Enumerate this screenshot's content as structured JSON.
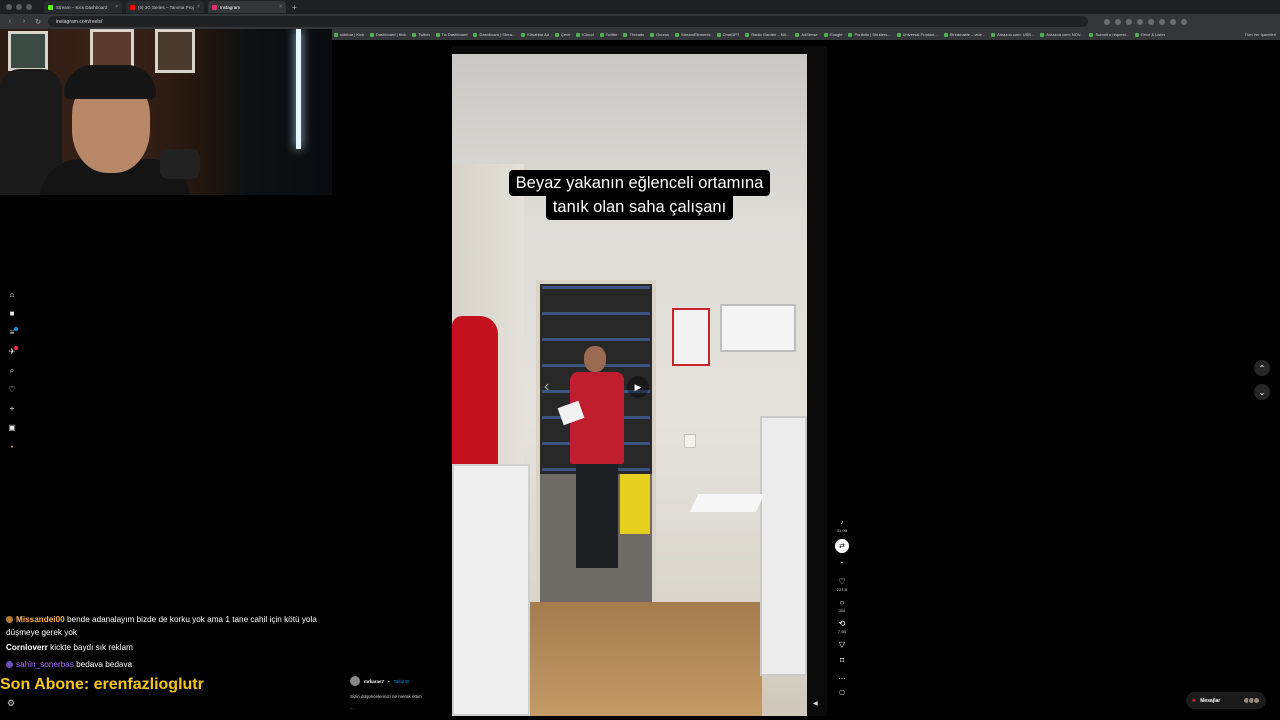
{
  "browser": {
    "tabs": [
      {
        "label": "Stream – Kick Dashboard",
        "color": "#53fc18"
      },
      {
        "label": "(6) 3G Series – Tanıma Proj...",
        "color": "#ff0000"
      },
      {
        "label": "Instagram",
        "color": "#e1306c"
      }
    ],
    "url": "instagram.com/reels/",
    "bookmarks": [
      "sidebar | Kick",
      "Dashboard | Kick",
      "Twitch",
      "Tw Dashboard",
      "Dashboard | Strea...",
      "Kirsahtar Ad",
      "Çevir",
      "iCloud",
      "Twitter",
      "Threads",
      "Ocurus",
      "StreamElements",
      "ChatGPT",
      "Radio Garden – Kili...",
      "AdSense",
      "Google",
      "Portfolio | Shutters...",
      "Universal Product...",
      "Streamable – vide...",
      "Amazon.com: USB...",
      "Amazon.com: NOV...",
      "Submit a request...",
      "Drive & Lister"
    ],
    "all_bookmarks": "Tüm Yer İşaretleri"
  },
  "chat": {
    "messages": [
      {
        "user": "Missandei00",
        "text": "bende adanalayım bizde de korku yok ama 1 tane cahil için kötü yola düşmeye gerek yok"
      },
      {
        "user": "Cornloverr",
        "text": "kickte baydı sık reklam"
      },
      {
        "user": "sahin_sonerbas",
        "text": "bedava bedava"
      }
    ],
    "sub_banner": "Son Abone: erenfazlioglutr"
  },
  "reel": {
    "caption_line1": "Beyaz yakanın eğlenceli ortamına",
    "caption_line2": "tanık olan saha çalışanı",
    "author": "mrkaras7",
    "follow": "Takip Et",
    "description": "Sizin düşüncelerinizi ne merak ettim",
    "more": "..."
  },
  "actions": {
    "likes": "223 B",
    "comments": "306",
    "reposts": "7,6B",
    "top_count": "31,0B"
  },
  "messages_label": "Mesajlar"
}
